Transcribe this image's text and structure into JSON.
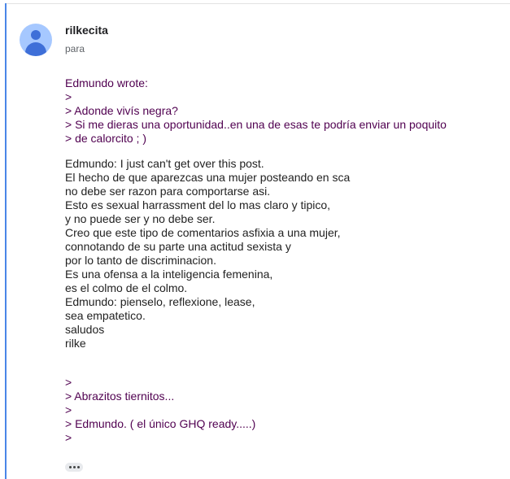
{
  "sender": {
    "name": "rilkecita",
    "recipient_label": "para"
  },
  "quote_top": [
    "Edmundo wrote:",
    ">",
    "> Adonde vivís negra?",
    "> Si me dieras una oportunidad..en una de esas te podría enviar un poquito",
    "> de calorcito ; )"
  ],
  "reply": [
    "Edmundo: I just can't get over this post.",
    "El hecho de que aparezcas una mujer posteando en sca",
    "no debe ser razon para comportarse asi.",
    "Esto es sexual harrassment del lo mas claro y tipico,",
    "y no puede ser y no debe ser.",
    "Creo que este tipo de comentarios asfixia a una mujer,",
    "connotando de su parte una actitud sexista y",
    "por lo tanto de discriminacion.",
    "Es una ofensa a la inteligencia femenina,",
    "es el colmo de el colmo.",
    "Edmundo: pienselo, reflexione, lease,",
    "sea empatetico.",
    "saludos",
    "rilke"
  ],
  "quote_bottom": [
    ">",
    "> Abrazitos tiernitos...",
    ">",
    "> Edmundo. ( el único GHQ ready.....)",
    ">"
  ],
  "icons": {
    "avatar": "person-avatar-icon",
    "more": "more-horizontal-icon"
  },
  "colors": {
    "accent": "#4a86e8",
    "quoted_text": "#500050",
    "avatar_bg": "#a6c8ff",
    "avatar_fg": "#3e6fd8"
  }
}
